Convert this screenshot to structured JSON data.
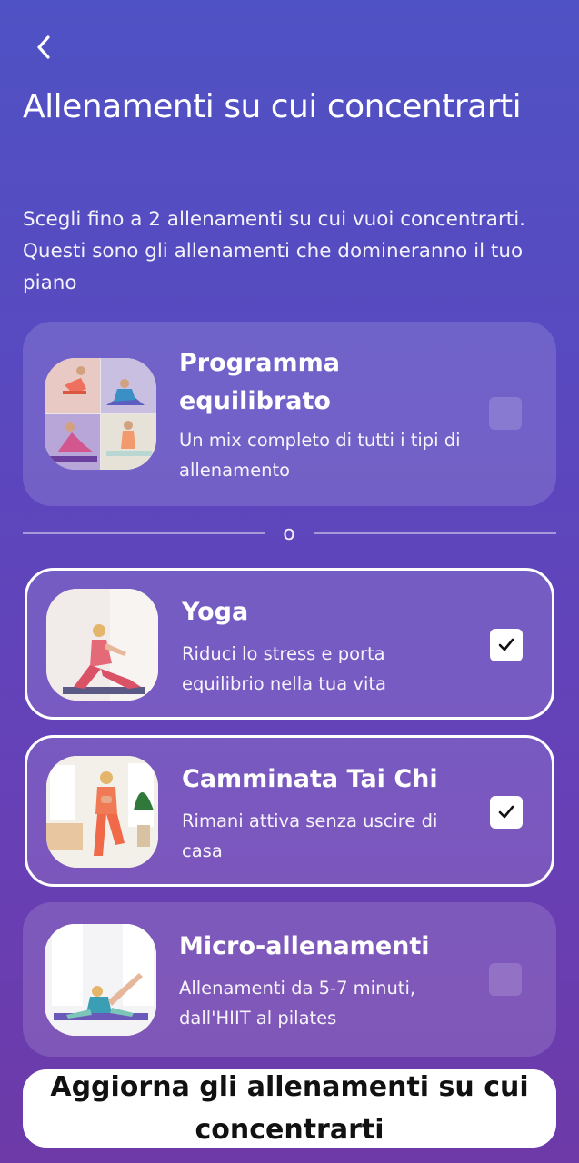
{
  "header": {
    "back_icon": "chevron-left-icon",
    "title": "Allenamenti su cui concentrarti",
    "subtitle": "Scegli fino a 2 allenamenti su cui vuoi concentrarti. Questi sono gli allenamenti che domineranno il tuo piano"
  },
  "balanced": {
    "title": "Programma equilibrato",
    "description": "Un mix completo di tutti i tipi di allenamento",
    "checked": false
  },
  "divider": {
    "label": "o"
  },
  "workouts": [
    {
      "title": "Yoga",
      "description": "Riduci lo stress e porta equilibrio nella tua vita",
      "checked": true
    },
    {
      "title": "Camminata Tai Chi",
      "description": "Rimani attiva senza uscire di casa",
      "checked": true
    },
    {
      "title": "Micro-allenamenti",
      "description": "Allenamenti da 5-7 minuti, dall'HIIT al pilates",
      "checked": false
    }
  ],
  "cta": {
    "label": "Aggiorna gli allenamenti su cui concentrarti"
  },
  "colors": {
    "background_top": "#4f52c4",
    "background_bottom": "#6d3aa8",
    "card_border_selected": "#ffffff",
    "cta_background": "#ffffff"
  }
}
